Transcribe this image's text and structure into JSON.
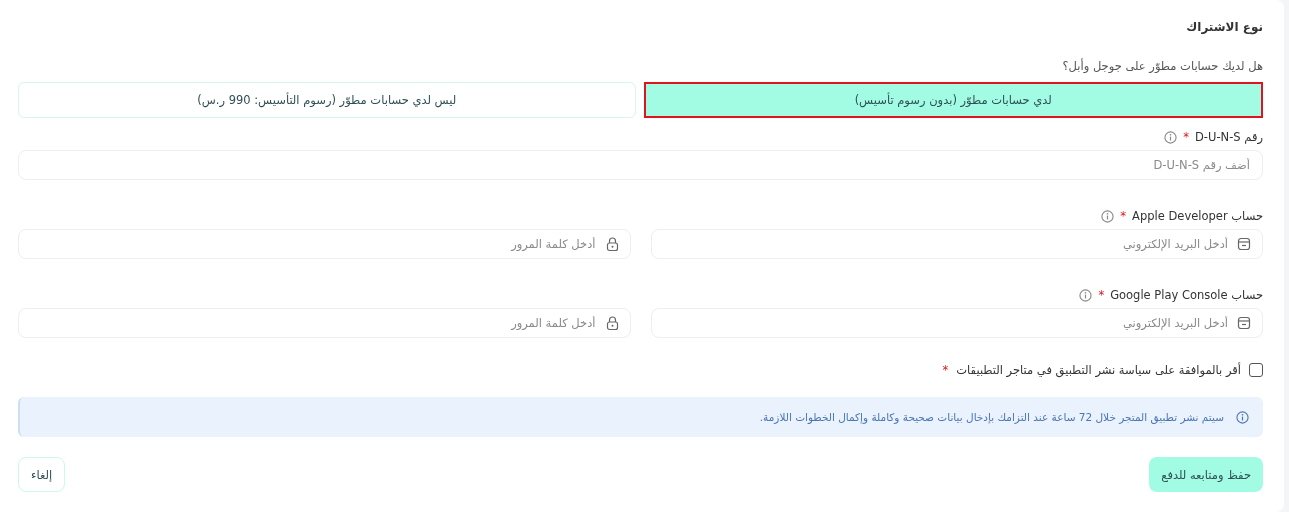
{
  "section_title": "نوع الاشتراك",
  "question": "هل لديك حسابات مطوّر على جوجل وأبل؟",
  "options": [
    {
      "label": "لدي حسابات مطوّر (بدون رسوم تأسيس)",
      "selected": true
    },
    {
      "label": "ليس لدي حسابات مطوّر (رسوم التأسيس: 990 ر.س)",
      "selected": false
    }
  ],
  "duns": {
    "label": "رقم D-U-N-S",
    "required_mark": "*",
    "placeholder": "أضف رقم D-U-N-S"
  },
  "accounts": [
    {
      "label": "حساب Apple Developer",
      "required_mark": "*",
      "email_placeholder": "أدخل البريد الإلكتروني",
      "password_placeholder": "أدخل كلمة المرور"
    },
    {
      "label": "حساب Google Play Console",
      "required_mark": "*",
      "email_placeholder": "أدخل البريد الإلكتروني",
      "password_placeholder": "أدخل كلمة المرور"
    }
  ],
  "agreement": {
    "label": "أقر بالموافقة على سياسة نشر التطبيق في متاجر التطبيقات",
    "required_mark": "*",
    "checked": false
  },
  "notice": "سيتم نشر تطبيق المتجر خلال 72 ساعة عند التزامك بإدخال بيانات صحيحة وكاملة وإكمال الخطوات اللازمة.",
  "buttons": [
    {
      "label": "حفظ ومتابعه للدفع",
      "kind": "primary"
    },
    {
      "label": "إلغاء",
      "kind": "secondary"
    }
  ]
}
